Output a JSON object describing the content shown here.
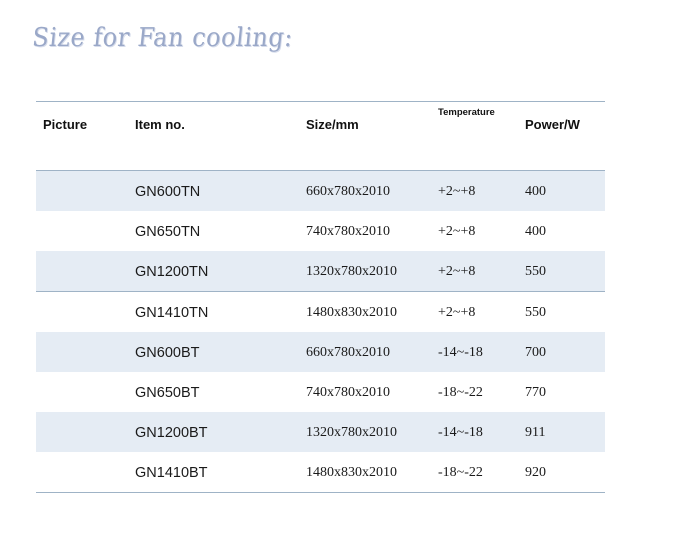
{
  "heading": "Size for Fan cooling:",
  "columns": {
    "picture": "Picture",
    "item": "Item no.",
    "size": "Size/mm",
    "temperature": "Temperature",
    "power": "Power/W"
  },
  "rows": [
    {
      "item": "GN600TN",
      "size": "660x780x2010",
      "temperature": "+2~+8",
      "power": "400"
    },
    {
      "item": "GN650TN",
      "size": "740x780x2010",
      "temperature": "+2~+8",
      "power": "400"
    },
    {
      "item": "GN1200TN",
      "size": "1320x780x2010",
      "temperature": "+2~+8",
      "power": "550"
    },
    {
      "item": "GN1410TN",
      "size": "1480x830x2010",
      "temperature": "+2~+8",
      "power": "550"
    },
    {
      "item": "GN600BT",
      "size": "660x780x2010",
      "temperature": "-14~-18",
      "power": "700"
    },
    {
      "item": "GN650BT",
      "size": "740x780x2010",
      "temperature": "-18~-22",
      "power": "770"
    },
    {
      "item": "GN1200BT",
      "size": "1320x780x2010",
      "temperature": "-14~-18",
      "power": "911"
    },
    {
      "item": "GN1410BT",
      "size": "1480x830x2010",
      "temperature": "-18~-22",
      "power": "920"
    }
  ],
  "colors": {
    "row_shade": "#e5ecf4",
    "rule": "#9fb3c6",
    "heading": "#9aa8c8"
  }
}
